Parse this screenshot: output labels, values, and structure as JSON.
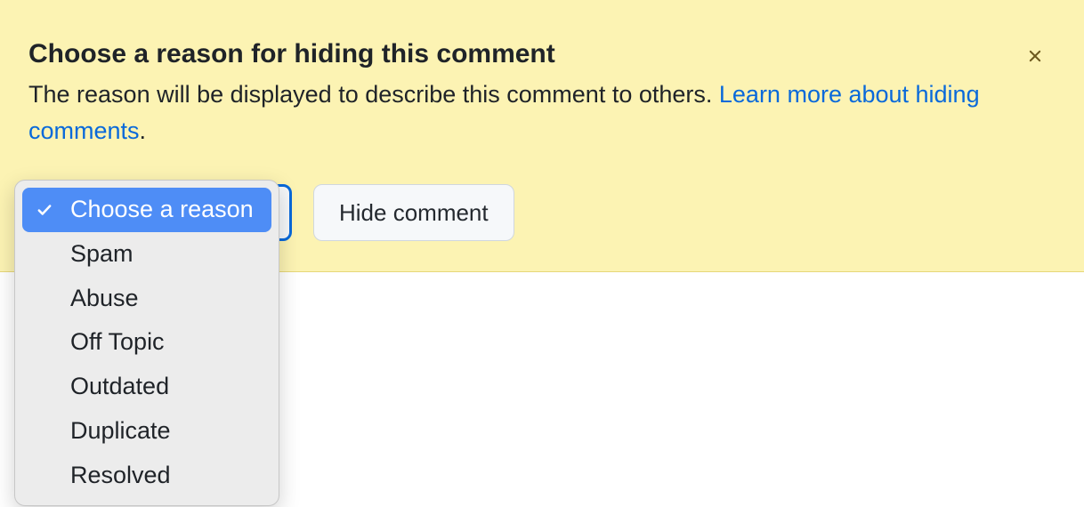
{
  "banner": {
    "title": "Choose a reason for hiding this comment",
    "desc_prefix": "The reason will be displayed to describe this comment to others. ",
    "link_text": "Learn more about hiding comments",
    "desc_suffix": "."
  },
  "select": {
    "trigger_label": "Choose a reason",
    "options": [
      "Choose a reason",
      "Spam",
      "Abuse",
      "Off Topic",
      "Outdated",
      "Duplicate",
      "Resolved"
    ],
    "selected_index": 0
  },
  "buttons": {
    "hide": "Hide comment"
  }
}
